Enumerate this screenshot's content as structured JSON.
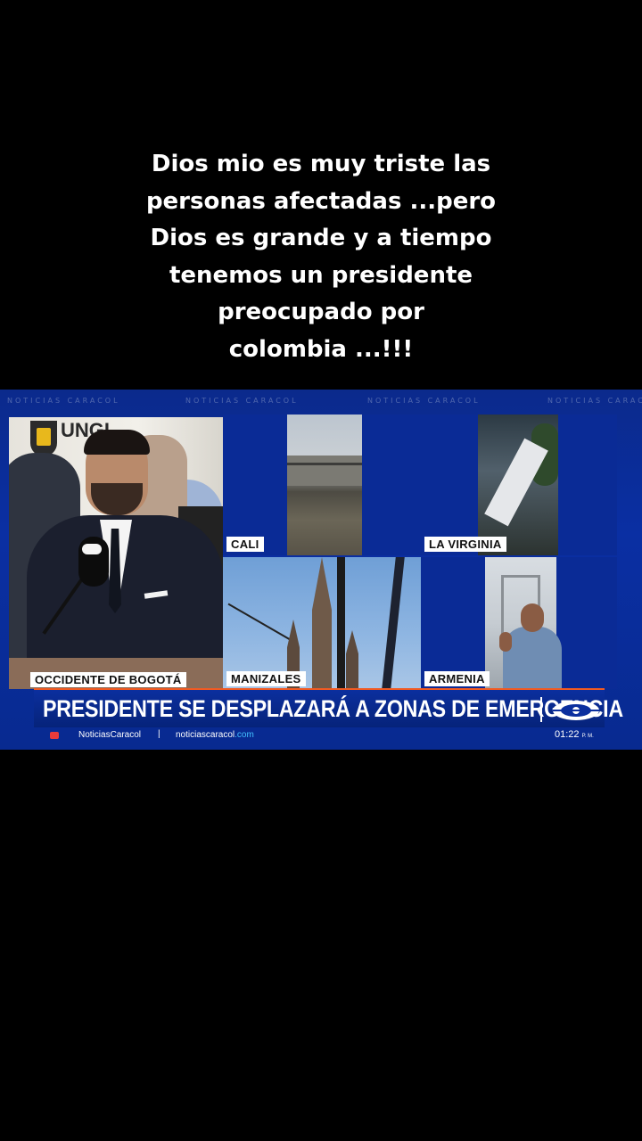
{
  "caption": {
    "lines": [
      "Dios mio es muy triste las",
      "personas afectadas ...pero",
      "Dios es grande y a tiempo",
      "tenemos un presidente",
      "preocupado por",
      "colombia ...!!!"
    ]
  },
  "broadcast": {
    "watermark_text": "NOTICIAS CARACOL",
    "panels": {
      "main_label": "OCCIDENTE DE BOGOTÁ",
      "logo_text": "UNGI",
      "cali_label": "CALI",
      "virginia_label": "LA VIRGINIA",
      "manizales_label": "MANIZALES",
      "armenia_label": "ARMENIA"
    },
    "headline": "PRESIDENTE SE DESPLAZARÁ A ZONAS DE EMERGENCIA",
    "ticker": {
      "handle": "NoticiasCaracol",
      "separator": "|",
      "site_name": "noticiascaracol",
      "site_tld": ".com",
      "time": "01:22",
      "time_suffix": "P. M."
    },
    "colors": {
      "brand_blue": "#0a2fa3",
      "accent_orange": "#f05a22",
      "link_cyan": "#42c0ff"
    },
    "icons": [
      "play-icon",
      "caracol-logo"
    ]
  }
}
